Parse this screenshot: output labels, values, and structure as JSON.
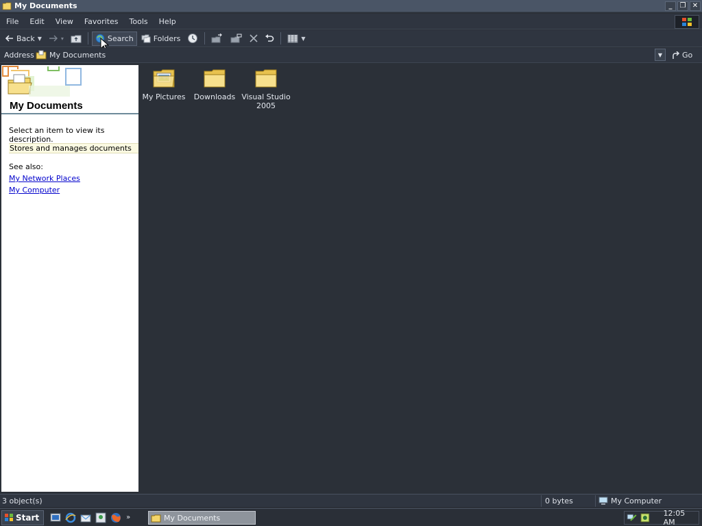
{
  "window": {
    "title": "My Documents"
  },
  "menu": {
    "items": [
      "File",
      "Edit",
      "View",
      "Favorites",
      "Tools",
      "Help"
    ]
  },
  "toolbar": {
    "back_label": "Back",
    "search_label": "Search",
    "folders_label": "Folders"
  },
  "address": {
    "label": "Address",
    "value": "My Documents",
    "go_label": "Go"
  },
  "left_pane": {
    "title": "My Documents",
    "hint": "Select an item to view its description.",
    "description": "Stores and manages documents",
    "see_also": "See also:",
    "links": [
      "My Network Places",
      "My Computer"
    ]
  },
  "files": [
    {
      "name": "My Pictures",
      "icon": "pictures-folder-icon"
    },
    {
      "name": "Downloads",
      "icon": "folder-icon"
    },
    {
      "name": "Visual Studio 2005",
      "icon": "folder-icon"
    }
  ],
  "status": {
    "objects": "3 object(s)",
    "size": "0 bytes",
    "location": "My Computer"
  },
  "taskbar": {
    "start_label": "Start",
    "task_label": "My Documents",
    "clock": "12:05 AM"
  }
}
